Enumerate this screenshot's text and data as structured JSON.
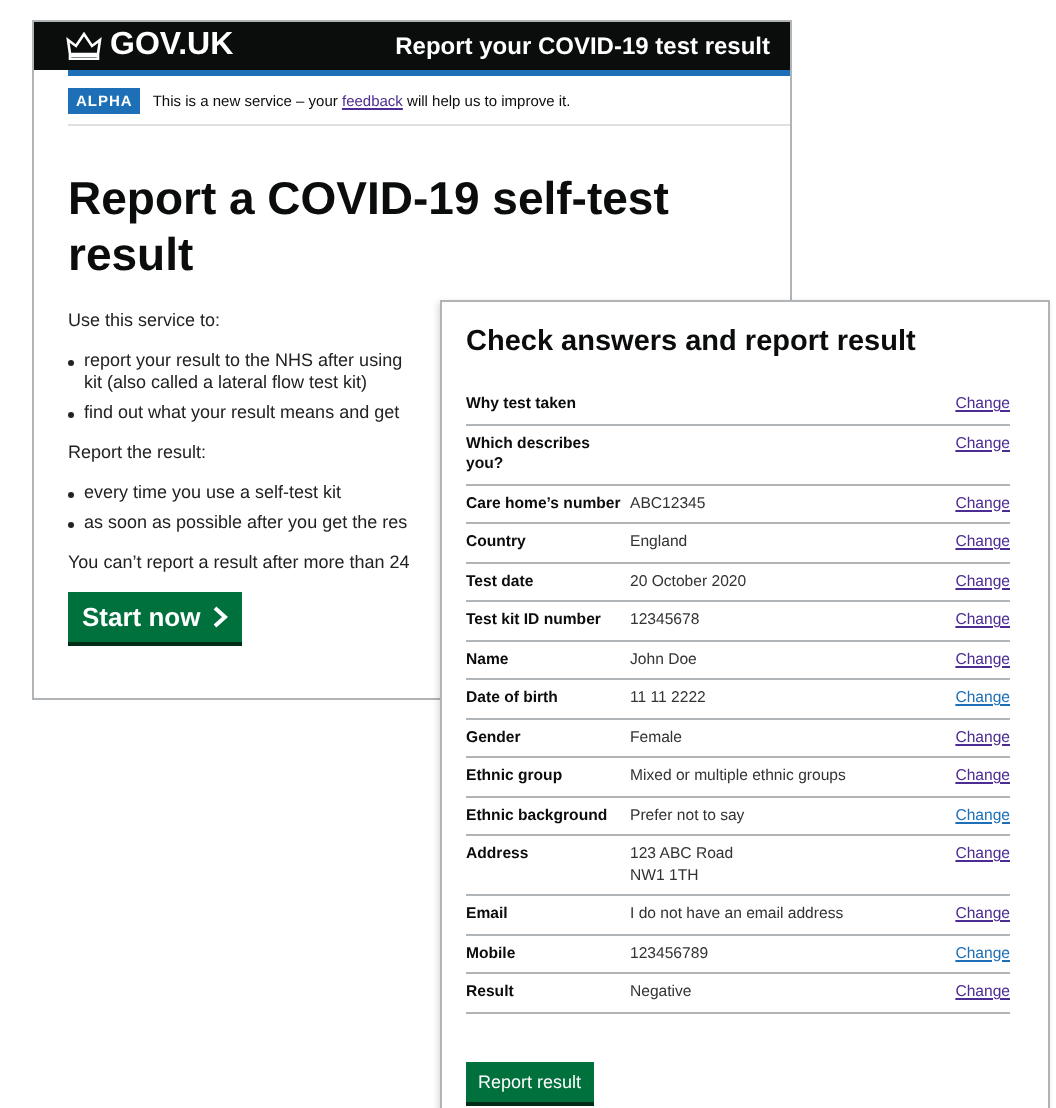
{
  "start_page": {
    "header": {
      "logo": "GOV.UK",
      "service": "Report your COVID-19 test result"
    },
    "phase_banner": {
      "tag": "ALPHA",
      "before": "This is a new service – your",
      "link": "feedback",
      "after": "will help us to improve it."
    },
    "title": "Report a COVID-19 self-test result",
    "blocks": [
      {
        "kind": "para",
        "text": "Use this service to:"
      },
      {
        "kind": "list",
        "items": [
          [
            "report your result to the NHS after using",
            "kit (also called a lateral flow test kit)"
          ],
          [
            "find out what your result means and get"
          ]
        ]
      },
      {
        "kind": "para",
        "text": "Report the result:"
      },
      {
        "kind": "list",
        "items": [
          [
            "every time you use a self-test kit"
          ],
          [
            "as soon as possible after you get the res"
          ]
        ]
      },
      {
        "kind": "para",
        "text": "You can’t report a result after more than 24"
      }
    ],
    "start_button": "Start now"
  },
  "check_page": {
    "title": "Check answers and report result",
    "rows": [
      {
        "key": "Why test taken",
        "action": "Change",
        "visited": true
      },
      {
        "key": "Which describes you?",
        "action": "Change",
        "visited": true
      },
      {
        "key": "Care home’s number",
        "value": "ABC12345",
        "action": "Change",
        "visited": true
      },
      {
        "key": "Country",
        "value": "England",
        "action": "Change",
        "visited": true
      },
      {
        "key": "Test date",
        "value": "20 October 2020",
        "action": "Change",
        "visited": true
      },
      {
        "key": "Test kit ID number",
        "value": "12345678",
        "action": "Change",
        "visited": true
      },
      {
        "key": "Name",
        "value": "John Doe",
        "action": "Change",
        "visited": true
      },
      {
        "key": "Date of birth",
        "value": "11 11 2222",
        "action": "Change",
        "visited": false
      },
      {
        "key": "Gender",
        "value": "Female",
        "action": "Change",
        "visited": true
      },
      {
        "key": "Ethnic group",
        "value": "Mixed or multiple ethnic groups",
        "action": "Change",
        "visited": true
      },
      {
        "key": "Ethnic background",
        "value": "Prefer not to say",
        "action": "Change",
        "visited": false
      },
      {
        "key": "Address",
        "value": "123 ABC Road\nNW1 1TH",
        "action": "Change",
        "visited": true
      },
      {
        "key": "Email",
        "value": "I do not have an email address",
        "action": "Change",
        "visited": true
      },
      {
        "key": "Mobile",
        "value": "123456789",
        "action": "Change",
        "visited": false
      },
      {
        "key": "Result",
        "value": "Negative",
        "action": "Change",
        "visited": true
      }
    ],
    "submit_button": "Report result"
  }
}
